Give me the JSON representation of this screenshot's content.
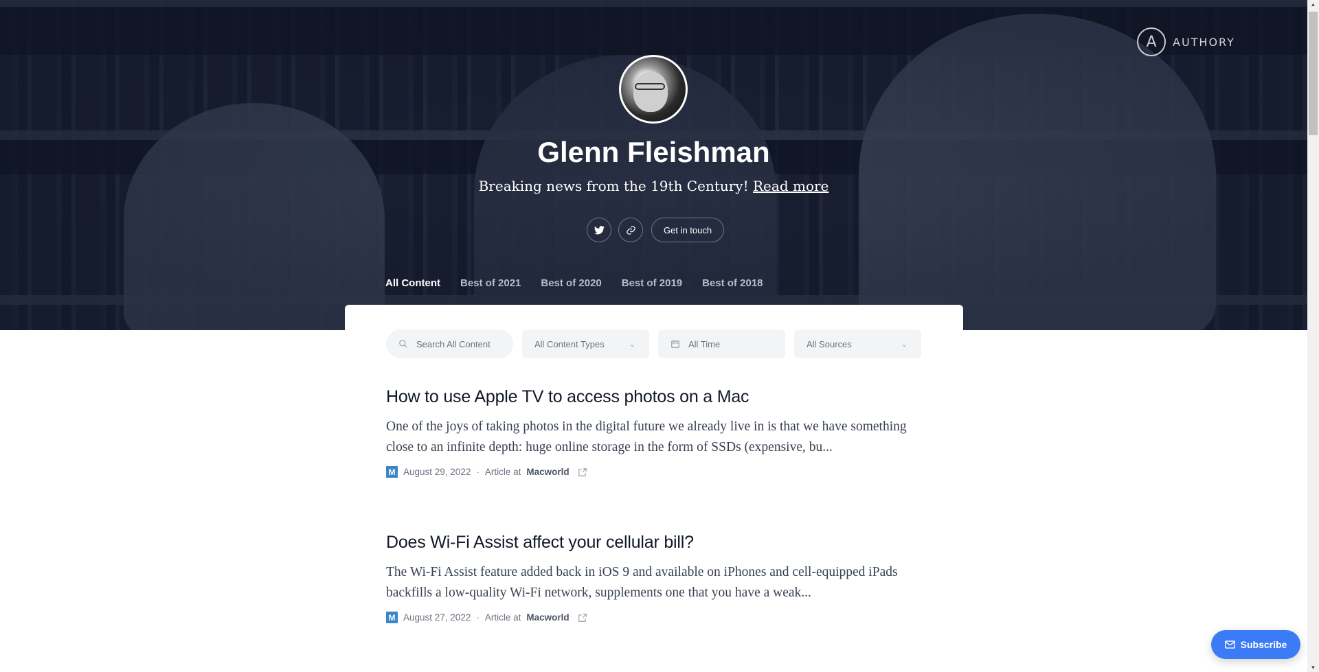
{
  "brand": {
    "name": "AUTHORY",
    "logo_glyph": "A"
  },
  "profile": {
    "name": "Glenn Fleishman",
    "tagline": "Breaking news from the 19th Century!",
    "read_more": "Read more",
    "avatar_icon": "avatar-photo"
  },
  "actions": {
    "twitter_icon": "twitter-icon",
    "link_icon": "link-icon",
    "get_in_touch": "Get in touch"
  },
  "tabs": [
    {
      "label": "All Content",
      "active": true
    },
    {
      "label": "Best of 2021",
      "active": false
    },
    {
      "label": "Best of 2020",
      "active": false
    },
    {
      "label": "Best of 2019",
      "active": false
    },
    {
      "label": "Best of 2018",
      "active": false
    }
  ],
  "filters": {
    "search_placeholder": "Search All Content",
    "content_types": "All Content Types",
    "time": "All Time",
    "sources": "All Sources"
  },
  "articles": [
    {
      "title": "How to use Apple TV to access photos on a Mac",
      "excerpt": "One of the joys of taking photos in the digital future we already live in is that we have something close to an infinite depth: huge online storage in the form of SSDs (expensive, bu...",
      "source_logo": "M",
      "date": "August 29, 2022",
      "type_prefix": "Article at",
      "source": "Macworld"
    },
    {
      "title": "Does Wi-Fi Assist affect your cellular bill?",
      "excerpt": "The Wi-Fi Assist feature added back in iOS 9 and available on iPhones and cell-equipped iPads backfills a low-quality Wi-Fi network, supplements one that you have a weak...",
      "source_logo": "M",
      "date": "August 27, 2022",
      "type_prefix": "Article at",
      "source": "Macworld"
    }
  ],
  "subscribe": {
    "label": "Subscribe"
  },
  "colors": {
    "accent": "#3b7bf5",
    "tab_underline": "#3b6fe3",
    "source_logo": "#3a86c8"
  }
}
